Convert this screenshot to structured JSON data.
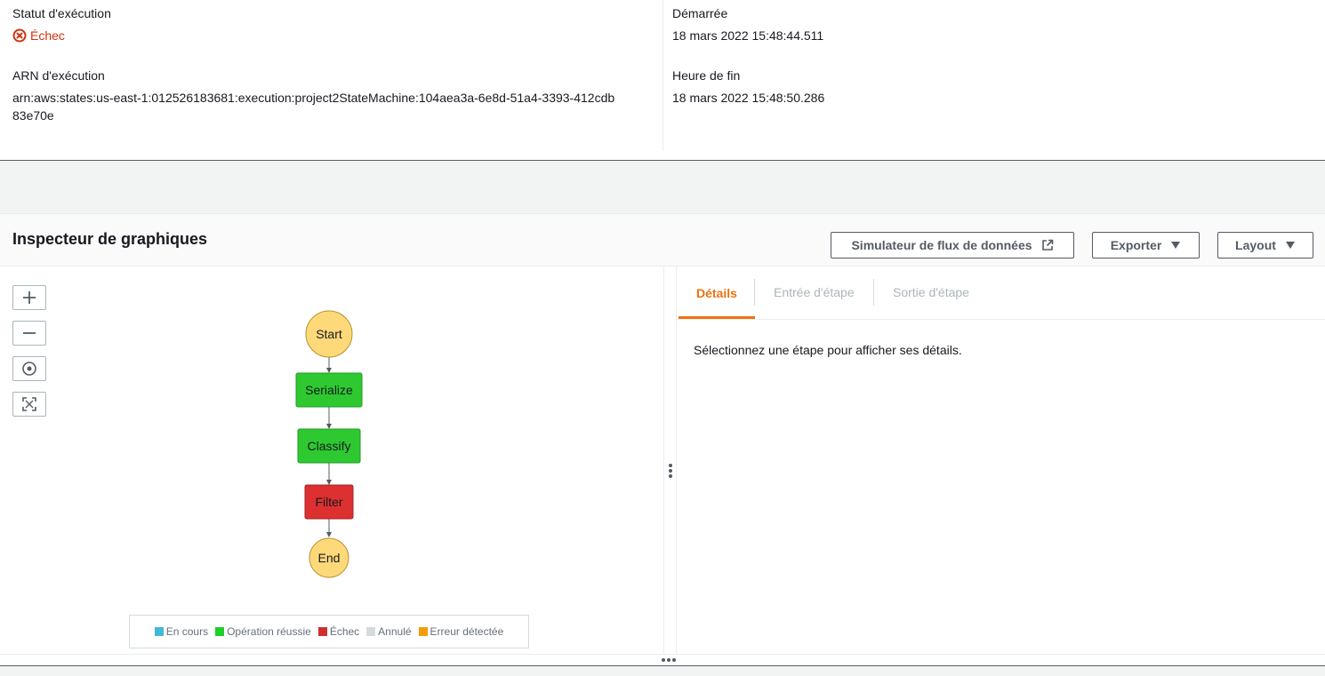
{
  "summary": {
    "status_label": "Statut d'exécution",
    "status_value": "Échec",
    "arn_label": "ARN d'exécution",
    "arn_value": "arn:aws:states:us-east-1:012526183681:execution:project2StateMachine:104aea3a-6e8d-51a4-3393-412cdb83e70e",
    "started_label": "Démarrée",
    "started_value": "18 mars 2022 15:48:44.511",
    "end_label": "Heure de fin",
    "end_value": "18 mars 2022 15:48:50.286"
  },
  "inspector": {
    "title": "Inspecteur de graphiques",
    "simulator_button": "Simulateur de flux de données",
    "export_button": "Exporter",
    "layout_button": "Layout"
  },
  "graph": {
    "nodes": [
      {
        "id": "start",
        "label": "Start",
        "shape": "circle",
        "status": "terminal"
      },
      {
        "id": "serialize",
        "label": "Serialize",
        "shape": "rect",
        "status": "succeeded"
      },
      {
        "id": "classify",
        "label": "Classify",
        "shape": "rect",
        "status": "succeeded"
      },
      {
        "id": "filter",
        "label": "Filter",
        "shape": "rect",
        "status": "failed"
      },
      {
        "id": "end",
        "label": "End",
        "shape": "circle",
        "status": "terminal"
      }
    ],
    "status_colors": {
      "terminal": "#fed97a",
      "succeeded": "#2ec930",
      "failed": "#dd3030"
    },
    "legend": [
      {
        "label": "En cours",
        "color": "#44b9d6"
      },
      {
        "label": "Opération réussie",
        "color": "#1ed028"
      },
      {
        "label": "Échec",
        "color": "#d12f2f"
      },
      {
        "label": "Annulé",
        "color": "#d5dbdb"
      },
      {
        "label": "Erreur détectée",
        "color": "#f39c0b"
      }
    ]
  },
  "details": {
    "tabs": [
      {
        "label": "Détails",
        "active": true
      },
      {
        "label": "Entrée d'étape",
        "active": false
      },
      {
        "label": "Sortie d'étape",
        "active": false
      }
    ],
    "empty_message": "Sélectionnez une étape pour afficher ses détails."
  },
  "icons": {
    "status": "error-circle-icon",
    "external_link": "external-link-icon",
    "caret": "caret-down-icon",
    "zoom_in": "plus-icon",
    "zoom_out": "minus-icon",
    "center": "target-icon",
    "fit": "fit-screen-icon"
  }
}
